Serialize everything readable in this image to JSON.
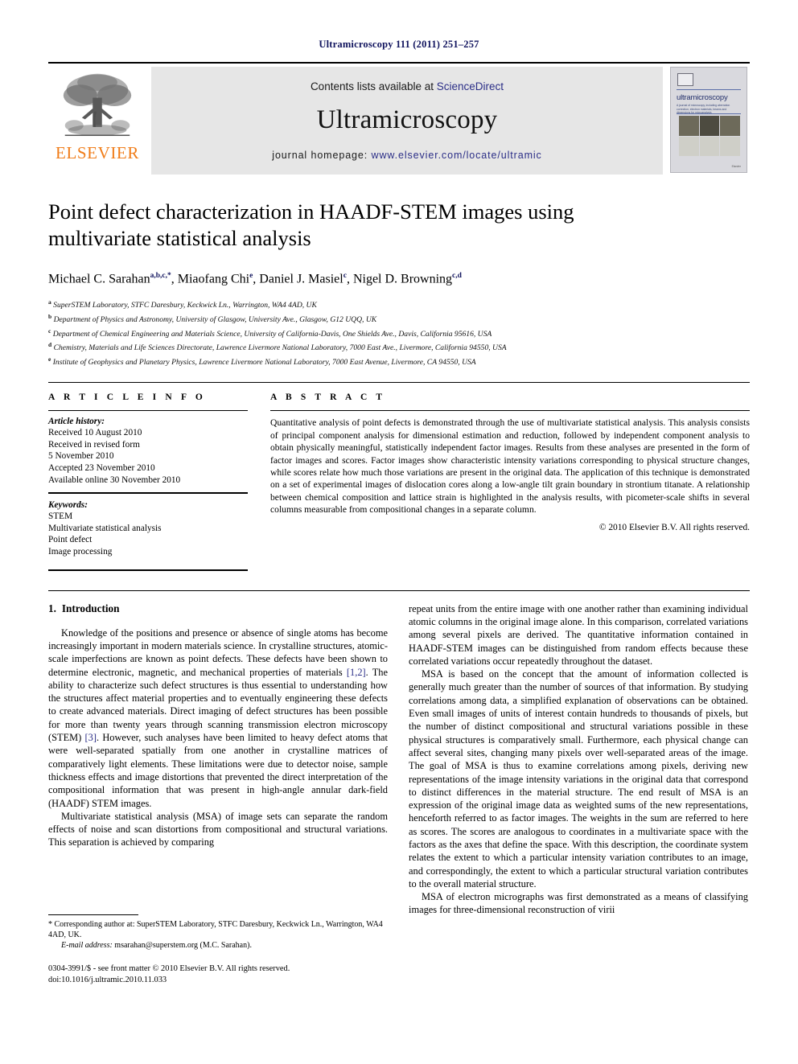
{
  "running_head": "Ultramicroscopy 111 (2011) 251–257",
  "masthead": {
    "publisher_name": "ELSEVIER",
    "contents_prefix": "Contents lists available at ",
    "contents_link": "ScienceDirect",
    "journal_title": "Ultramicroscopy",
    "homepage_prefix": "journal homepage: ",
    "homepage_url": "www.elsevier.com/locate/ultramic",
    "cover": {
      "title": "ultramicroscopy",
      "subtitle": "A journal of microscopy, including aberration correction, electron materials, beams and dimensions for microanalysis",
      "footer": "Elsevier"
    }
  },
  "article": {
    "title": "Point defect characterization in HAADF-STEM images using multivariate statistical analysis",
    "authors": [
      {
        "name": "Michael C. Sarahan",
        "marks": "a,b,c,*"
      },
      {
        "name": "Miaofang Chi",
        "marks": "e"
      },
      {
        "name": "Daniel J. Masiel",
        "marks": "c"
      },
      {
        "name": "Nigel D. Browning",
        "marks": "c,d"
      }
    ],
    "affiliations": [
      {
        "mark": "a",
        "text": "SuperSTEM Laboratory, STFC Daresbury, Keckwick Ln., Warrington, WA4 4AD, UK"
      },
      {
        "mark": "b",
        "text": "Department of Physics and Astronomy, University of Glasgow, University Ave., Glasgow, G12 UQQ, UK"
      },
      {
        "mark": "c",
        "text": "Department of Chemical Engineering and Materials Science, University of California-Davis, One Shields Ave., Davis, California 95616, USA"
      },
      {
        "mark": "d",
        "text": "Chemistry, Materials and Life Sciences Directorate, Lawrence Livermore National Laboratory, 7000 East Ave., Livermore, California 94550, USA"
      },
      {
        "mark": "e",
        "text": "Institute of Geophysics and Planetary Physics, Lawrence Livermore National Laboratory, 7000 East Avenue, Livermore, CA 94550, USA"
      }
    ]
  },
  "article_info": {
    "heading": "A R T I C L E   I N F O",
    "history_heading": "Article history:",
    "history": [
      "Received 10 August 2010",
      "Received in revised form",
      "5 November 2010",
      "Accepted 23 November 2010",
      "Available online 30 November 2010"
    ],
    "keywords_heading": "Keywords:",
    "keywords": [
      "STEM",
      "Multivariate statistical analysis",
      "Point defect",
      "Image processing"
    ]
  },
  "abstract": {
    "heading": "A B S T R A C T",
    "text": "Quantitative analysis of point defects is demonstrated through the use of multivariate statistical analysis. This analysis consists of principal component analysis for dimensional estimation and reduction, followed by independent component analysis to obtain physically meaningful, statistically independent factor images. Results from these analyses are presented in the form of factor images and scores. Factor images show characteristic intensity variations corresponding to physical structure changes, while scores relate how much those variations are present in the original data. The application of this technique is demonstrated on a set of experimental images of dislocation cores along a low-angle tilt grain boundary in strontium titanate. A relationship between chemical composition and lattice strain is highlighted in the analysis results, with picometer-scale shifts in several columns measurable from compositional changes in a separate column.",
    "copyright": "© 2010 Elsevier B.V. All rights reserved."
  },
  "body": {
    "section_number": "1.",
    "section_title": "Introduction",
    "left_paragraphs": [
      {
        "segments": [
          {
            "t": "Knowledge of the positions and presence or absence of single atoms has become increasingly important in modern materials science. In crystalline structures, atomic-scale imperfections are known as point defects. These defects have been shown to determine electronic, magnetic, and mechanical properties of materials "
          },
          {
            "t": "[1,2]",
            "cite": true
          },
          {
            "t": ". The ability to characterize such defect structures is thus essential to understanding how the structures affect material properties and to eventually engineering these defects to create advanced materials. Direct imaging of defect structures has been possible for more than twenty years through scanning transmission electron microscopy (STEM) "
          },
          {
            "t": "[3]",
            "cite": true
          },
          {
            "t": ". However, such analyses have been limited to heavy defect atoms that were well-separated spatially from one another in crystalline matrices of comparatively light elements. These limitations were due to detector noise, sample thickness effects and image distortions that prevented the direct interpretation of the compositional information that was present in high-angle annular dark-field (HAADF) STEM images."
          }
        ]
      },
      {
        "segments": [
          {
            "t": "Multivariate statistical analysis (MSA) of image sets can separate the random effects of noise and scan distortions from compositional and structural variations. This separation is achieved by comparing"
          }
        ]
      }
    ],
    "right_paragraphs": [
      {
        "segments": [
          {
            "t": "repeat units from the entire image with one another rather than examining individual atomic columns in the original image alone. In this comparison, correlated variations among several pixels are derived. The quantitative information contained in HAADF-STEM images can be distinguished from random effects because these correlated variations occur repeatedly throughout the dataset."
          }
        ],
        "no_indent": true
      },
      {
        "segments": [
          {
            "t": "MSA is based on the concept that the amount of information collected is generally much greater than the number of sources of that information. By studying correlations among data, a simplified explanation of observations can be obtained. Even small images of units of interest contain hundreds to thousands of pixels, but the number of distinct compositional and structural variations possible in these physical structures is comparatively small. Furthermore, each physical change can affect several sites, changing many pixels over well-separated areas of the image. The goal of MSA is thus to examine correlations among pixels, deriving new representations of the image intensity variations in the original data that correspond to distinct differences in the material structure. The end result of MSA is an expression of the original image data as weighted sums of the new representations, henceforth referred to as factor images. The weights in the sum are referred to here as scores. The scores are analogous to coordinates in a multivariate space with the factors as the axes that define the space. With this description, the coordinate system relates the extent to which a particular intensity variation contributes to an image, and correspondingly, the extent to which a particular structural variation contributes to the overall material structure."
          }
        ]
      },
      {
        "segments": [
          {
            "t": "MSA of electron micrographs was first demonstrated as a means of classifying images for three-dimensional reconstruction of virii"
          }
        ]
      }
    ]
  },
  "footnotes": {
    "corresponding": "* Corresponding author at: SuperSTEM Laboratory, STFC Daresbury, Keckwick Ln., Warrington, WA4 4AD, UK.",
    "email_label": "E-mail address:",
    "email": "msarahan@superstem.org (M.C. Sarahan).",
    "issn_line": "0304-3991/$ - see front matter © 2010 Elsevier B.V. All rights reserved.",
    "doi_line": "doi:10.1016/j.ultramic.2010.11.033"
  }
}
